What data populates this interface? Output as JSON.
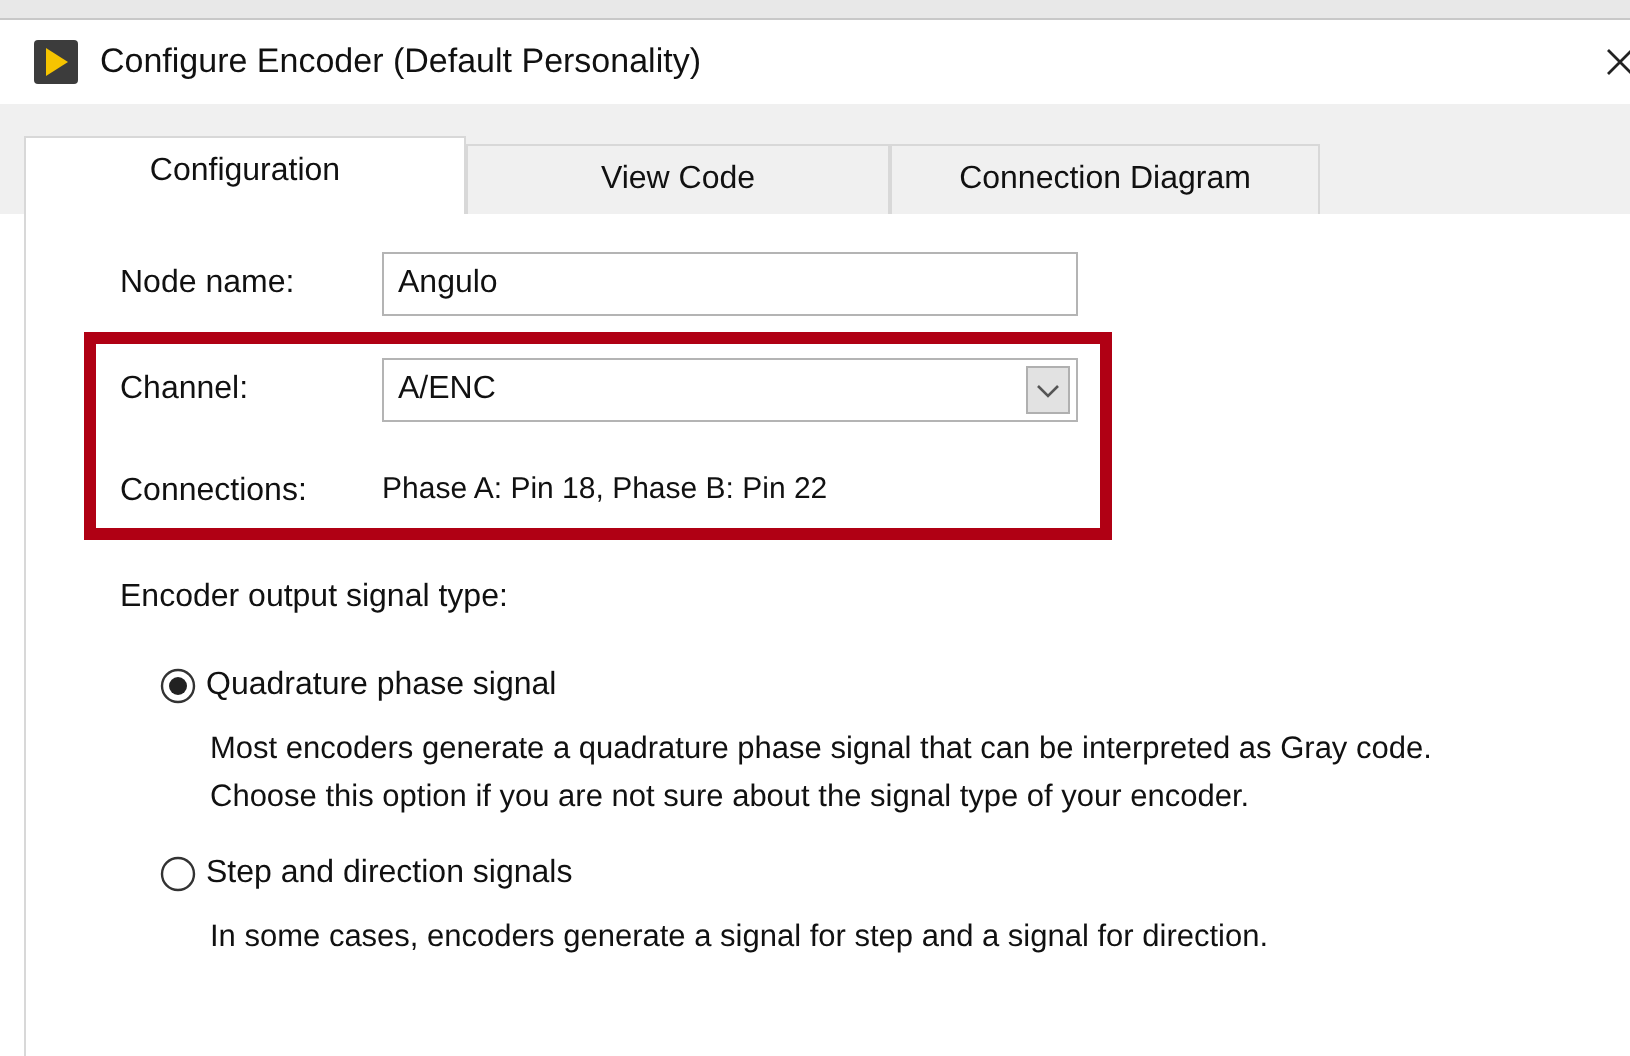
{
  "window": {
    "title": "Configure Encoder (Default Personality)"
  },
  "tabs": [
    {
      "label": "Configuration",
      "selected": true
    },
    {
      "label": "View Code",
      "selected": false
    },
    {
      "label": "Connection Diagram",
      "selected": false
    }
  ],
  "form": {
    "node_name": {
      "label": "Node name:",
      "value": "Angulo"
    },
    "channel": {
      "label": "Channel:",
      "value": "A/ENC"
    },
    "connections": {
      "label": "Connections:",
      "value": "Phase A: Pin 18, Phase B: Pin 22"
    }
  },
  "signal_type": {
    "label": "Encoder output signal type:",
    "options": [
      {
        "label": "Quadrature phase signal",
        "selected": true,
        "description": "Most encoders generate a quadrature phase signal that can be interpreted as Gray code. Choose this option if you are not sure about the signal type of your encoder."
      },
      {
        "label": "Step and direction signals",
        "selected": false,
        "description": "In some cases, encoders generate a signal for step and a signal for direction."
      }
    ]
  }
}
